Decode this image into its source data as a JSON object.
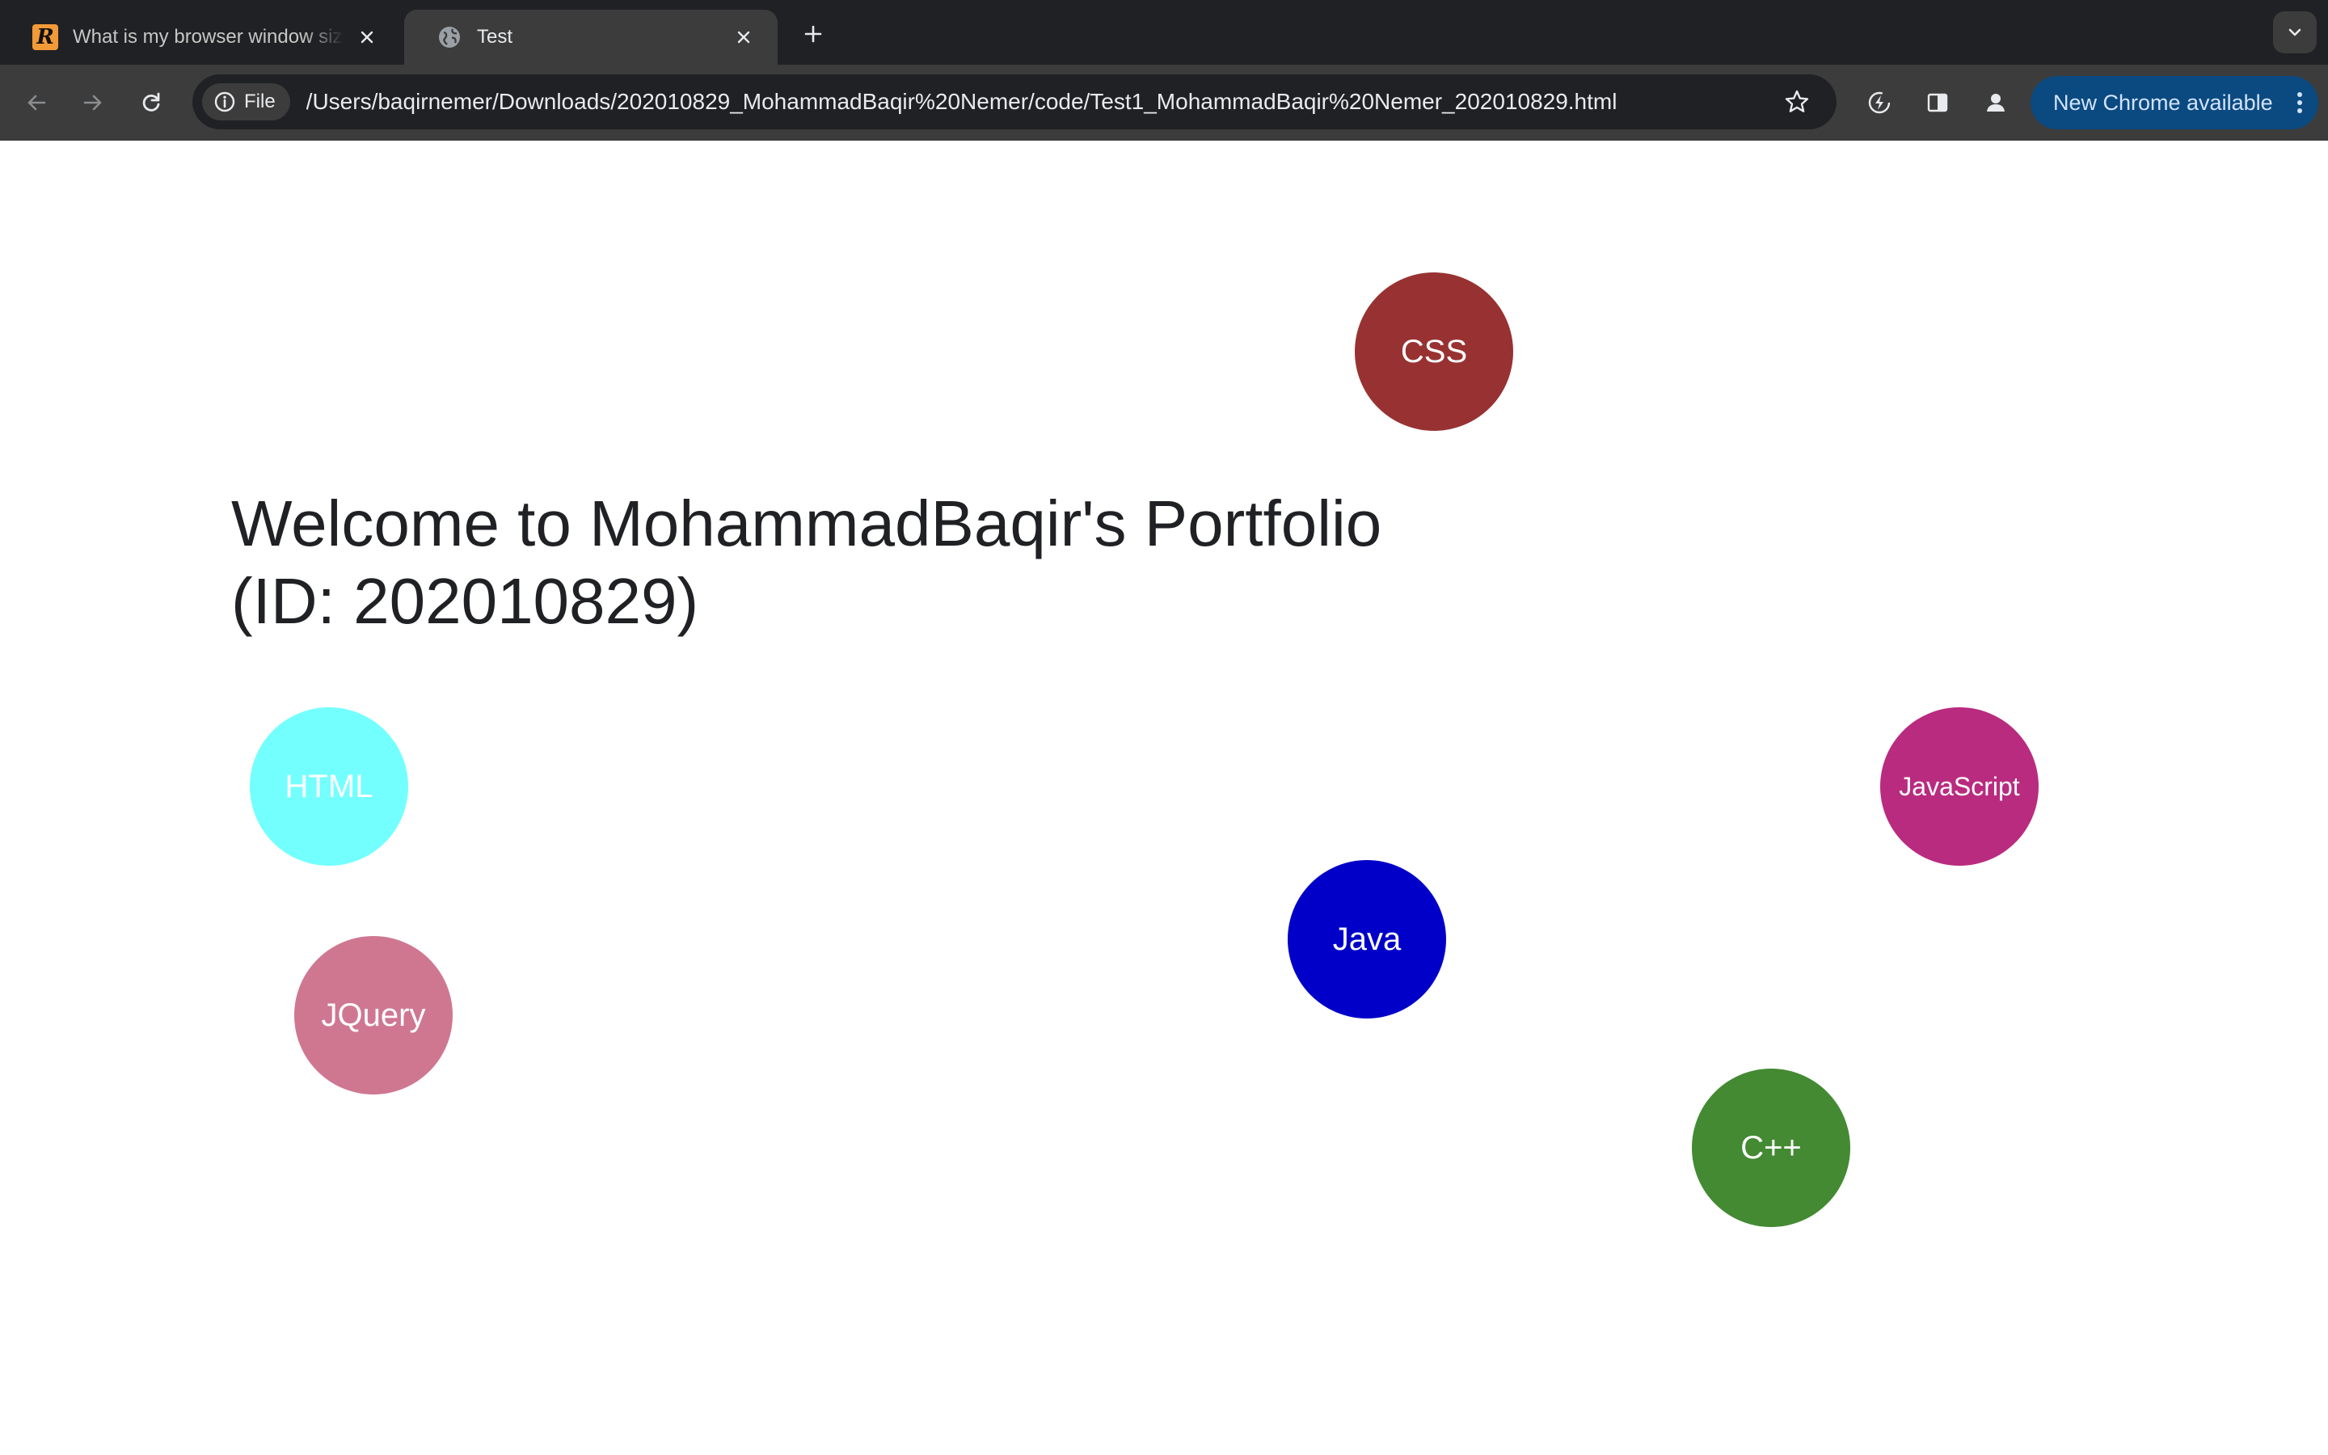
{
  "browser": {
    "tabs": [
      {
        "title": "What is my browser window size?",
        "favicon": "r-logo-icon",
        "active": false
      },
      {
        "title": "Test",
        "favicon": "globe-icon",
        "active": true
      }
    ],
    "toolbar": {
      "site_chip_label": "File",
      "url": "/Users/baqirnemer/Downloads/202010829_MohammadBaqir%20Nemer/code/Test1_MohammadBaqir%20Nemer_202010829.html",
      "update_button_label": "New Chrome available"
    }
  },
  "page": {
    "heading_line1": "Welcome to MohammadBaqir's Portfolio",
    "heading_line2": "(ID: 202010829)",
    "skills": [
      {
        "label": "CSS",
        "color": "#983232"
      },
      {
        "label": "HTML",
        "color": "#74ffff"
      },
      {
        "label": "JavaScript",
        "color": "#b92b7f"
      },
      {
        "label": "Java",
        "color": "#0000c8"
      },
      {
        "label": "JQuery",
        "color": "#cf7791"
      },
      {
        "label": "C++",
        "color": "#438a33"
      }
    ]
  },
  "colors": {
    "tabstrip": "#202124",
    "toolbar": "#3c3c3c",
    "update_button": "#0b4a80",
    "page_background": "#ffffff"
  }
}
